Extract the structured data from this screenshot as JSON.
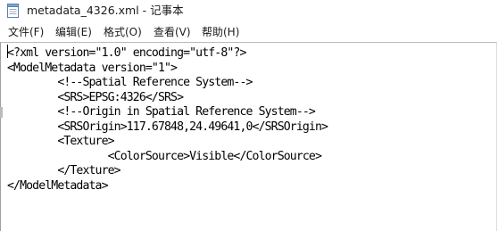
{
  "window": {
    "title": "metadata_4326.xml - 记事本",
    "icon": "notepad-icon"
  },
  "menu": {
    "items": [
      {
        "label": "文件(F)"
      },
      {
        "label": "编辑(E)"
      },
      {
        "label": "格式(O)"
      },
      {
        "label": "查看(V)"
      },
      {
        "label": "帮助(H)"
      }
    ]
  },
  "editor": {
    "lines": [
      "<?xml version=\"1.0\" encoding=\"utf-8\"?>",
      "<ModelMetadata version=\"1\">",
      "        <!--Spatial Reference System-->",
      "        <SRS>EPSG:4326</SRS>",
      "        <!--Origin in Spatial Reference System-->",
      "        <SRSOrigin>117.67848,24.49641,0</SRSOrigin>",
      "        <Texture>",
      "                <ColorSource>Visible</ColorSource>",
      "        </Texture>",
      "</ModelMetadata>"
    ]
  }
}
